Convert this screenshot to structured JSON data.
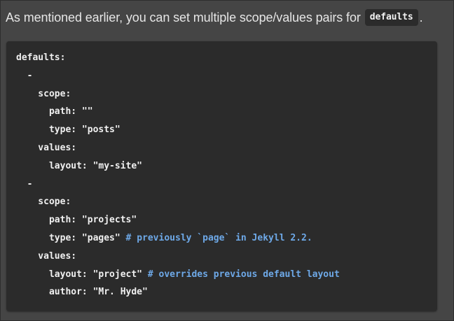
{
  "intro": {
    "text": "As mentioned earlier, you can set multiple scope/values pairs for",
    "code": "defaults",
    "end": "."
  },
  "code_block": {
    "lines": [
      {
        "code": "defaults:",
        "comment": ""
      },
      {
        "code": "  -",
        "comment": ""
      },
      {
        "code": "    scope:",
        "comment": ""
      },
      {
        "code": "      path: \"\"",
        "comment": ""
      },
      {
        "code": "      type: \"posts\"",
        "comment": ""
      },
      {
        "code": "    values:",
        "comment": ""
      },
      {
        "code": "      layout: \"my-site\"",
        "comment": ""
      },
      {
        "code": "  -",
        "comment": ""
      },
      {
        "code": "    scope:",
        "comment": ""
      },
      {
        "code": "      path: \"projects\"",
        "comment": ""
      },
      {
        "code": "      type: \"pages\" ",
        "comment": "# previously `page` in Jekyll 2.2."
      },
      {
        "code": "    values:",
        "comment": ""
      },
      {
        "code": "      layout: \"project\" ",
        "comment": "# overrides previous default layout"
      },
      {
        "code": "      author: \"Mr. Hyde\"",
        "comment": ""
      }
    ]
  }
}
